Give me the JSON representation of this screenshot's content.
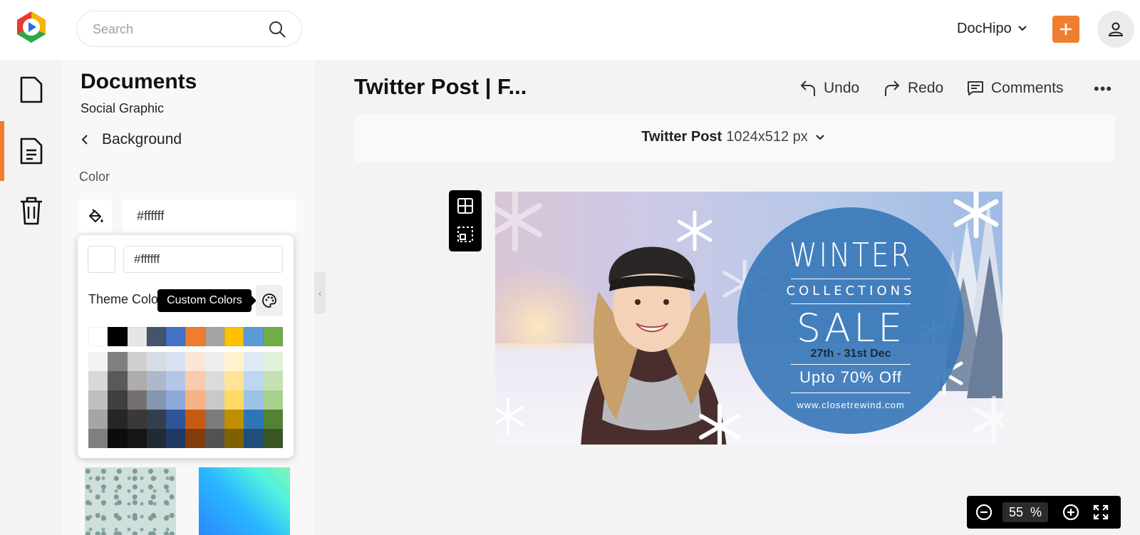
{
  "header": {
    "search_placeholder": "Search",
    "account_name": "DocHipo"
  },
  "panel": {
    "title": "Documents",
    "subtitle": "Social Graphic",
    "back_label": "Background",
    "color_label": "Color",
    "color_value": "#ffffff"
  },
  "picker": {
    "hex_value": "#ffffff",
    "theme_label": "Theme Colors",
    "tooltip": "Custom Colors",
    "theme_colors": [
      "#ffffff",
      "#000000",
      "#e7e6e6",
      "#44546a",
      "#4472c4",
      "#ed7d31",
      "#a5a5a5",
      "#ffc000",
      "#5b9bd5",
      "#70ad47"
    ],
    "shades": [
      [
        "#f2f2f2",
        "#7f7f7f",
        "#d0cece",
        "#d6dce4",
        "#d9e2f3",
        "#fbe5d5",
        "#ededed",
        "#fff2cc",
        "#deebf6",
        "#e2efd9"
      ],
      [
        "#d8d8d8",
        "#595959",
        "#aeabab",
        "#adb9ca",
        "#b4c6e7",
        "#f7cbac",
        "#dbdbdb",
        "#fee599",
        "#bdd7ee",
        "#c5e0b3"
      ],
      [
        "#bfbfbf",
        "#3f3f3f",
        "#757070",
        "#8496b0",
        "#8eaadb",
        "#f4b183",
        "#c9c9c9",
        "#ffd965",
        "#9cc3e5",
        "#a8d08d"
      ],
      [
        "#a5a5a5",
        "#262626",
        "#3a3838",
        "#323f4f",
        "#2f5496",
        "#c55a11",
        "#7b7b7b",
        "#bf8f00",
        "#2e75b5",
        "#538135"
      ],
      [
        "#7f7f7f",
        "#0c0c0c",
        "#171616",
        "#222a35",
        "#1f3864",
        "#833c0b",
        "#525252",
        "#7f6000",
        "#1e4e79",
        "#375623"
      ]
    ]
  },
  "editor": {
    "doc_title": "Twitter Post | F...",
    "undo": "Undo",
    "redo": "Redo",
    "comments": "Comments",
    "size_name": "Twitter Post",
    "size_dims": "1024x512 px"
  },
  "design": {
    "winter": "WINTER",
    "collections": "COLLECTIONS",
    "sale": "SALE",
    "dates": "27th - 31st Dec",
    "offer": "Upto 70% Off",
    "url": "www.closetrewind.com"
  },
  "zoom": {
    "value": "55",
    "unit": "%"
  },
  "colors": {
    "accent": "#f07e2f",
    "design_circle": "#3a78b8"
  }
}
